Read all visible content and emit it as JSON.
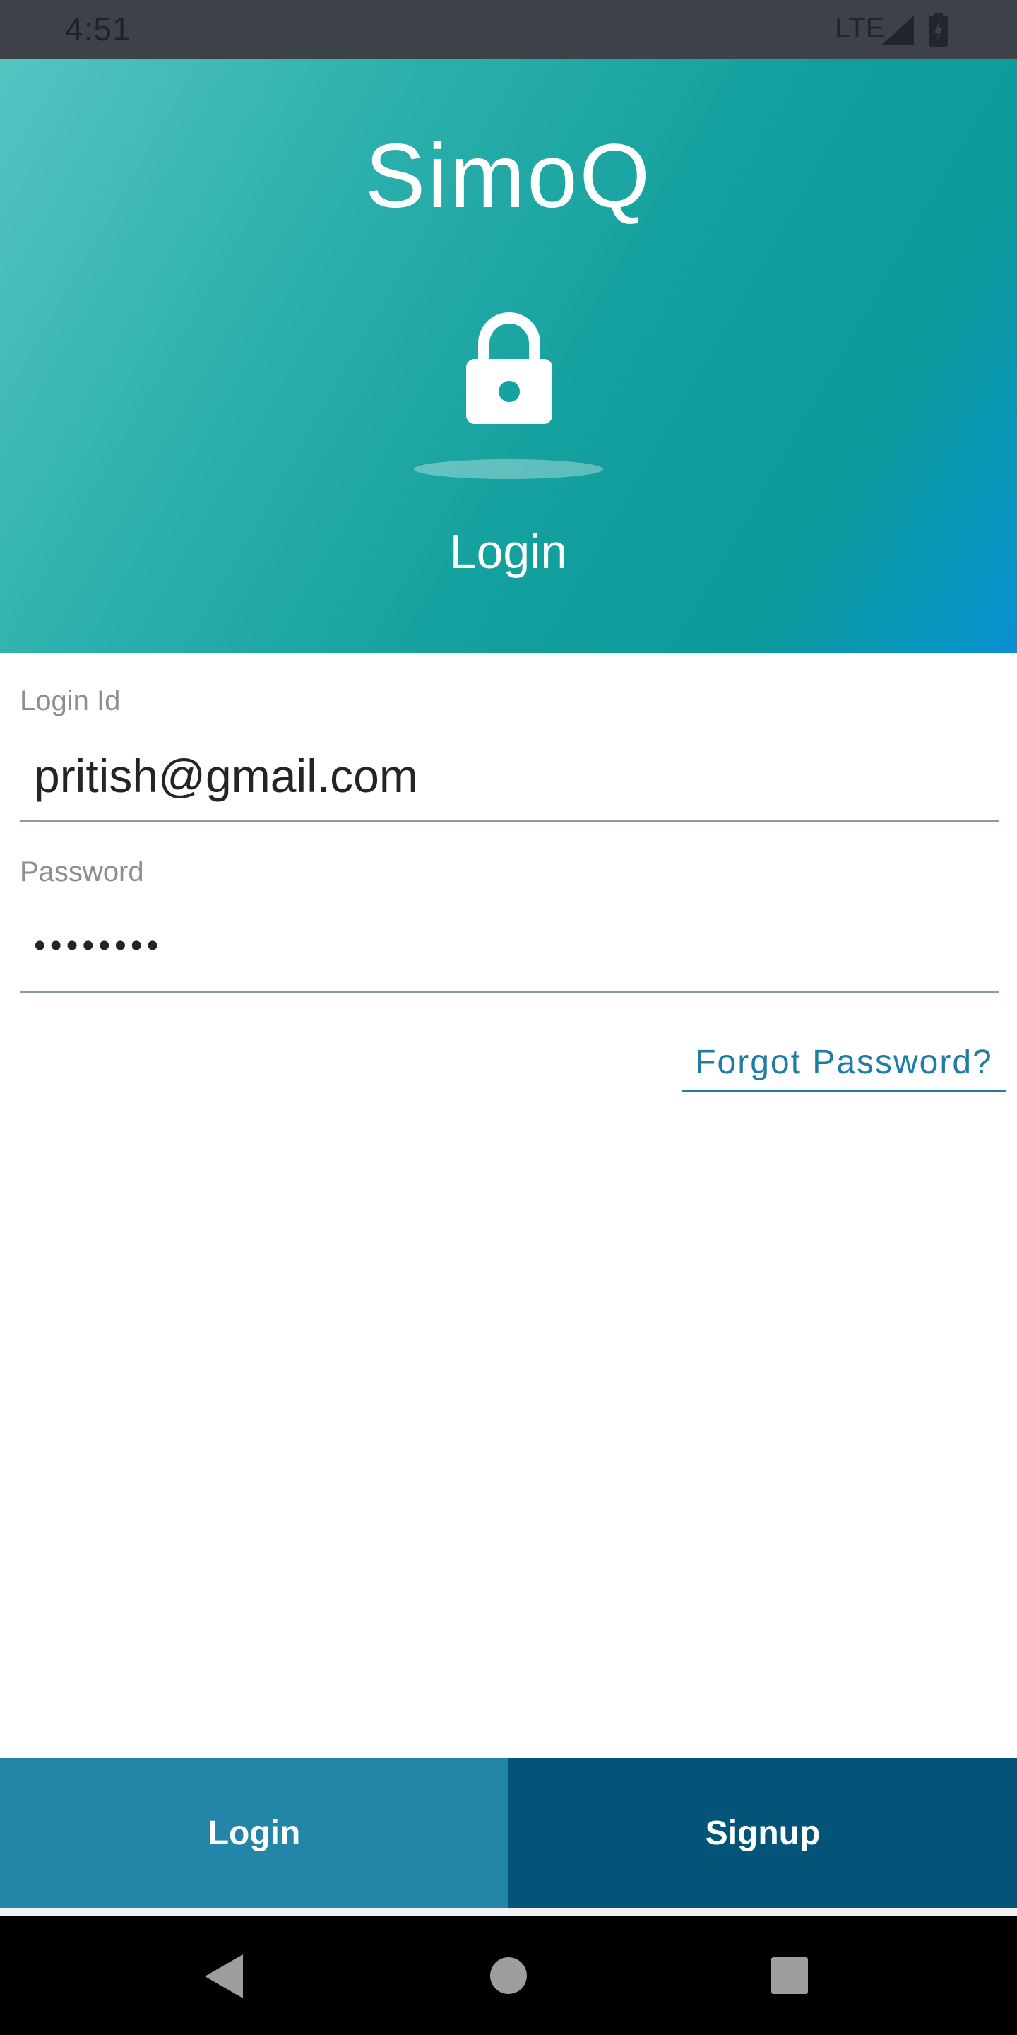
{
  "status_bar": {
    "time": "4:51",
    "network": "LTE"
  },
  "header": {
    "app_title": "SimoQ",
    "subtitle": "Login"
  },
  "form": {
    "login_id": {
      "label": "Login Id",
      "value": "pritish@gmail.com"
    },
    "password": {
      "label": "Password",
      "value": "••••••••"
    },
    "forgot_password": "Forgot Password?"
  },
  "actions": {
    "login": "Login",
    "signup": "Signup"
  },
  "colors": {
    "header_gradient_start": "#55c4c1",
    "header_gradient_end": "#0a8fd0",
    "link": "#1f7da4",
    "login_button": "#2386a8",
    "signup_button": "#035478"
  },
  "icons": [
    "lock-icon",
    "signal-icon",
    "battery-icon",
    "back-icon",
    "home-icon",
    "recents-icon"
  ]
}
